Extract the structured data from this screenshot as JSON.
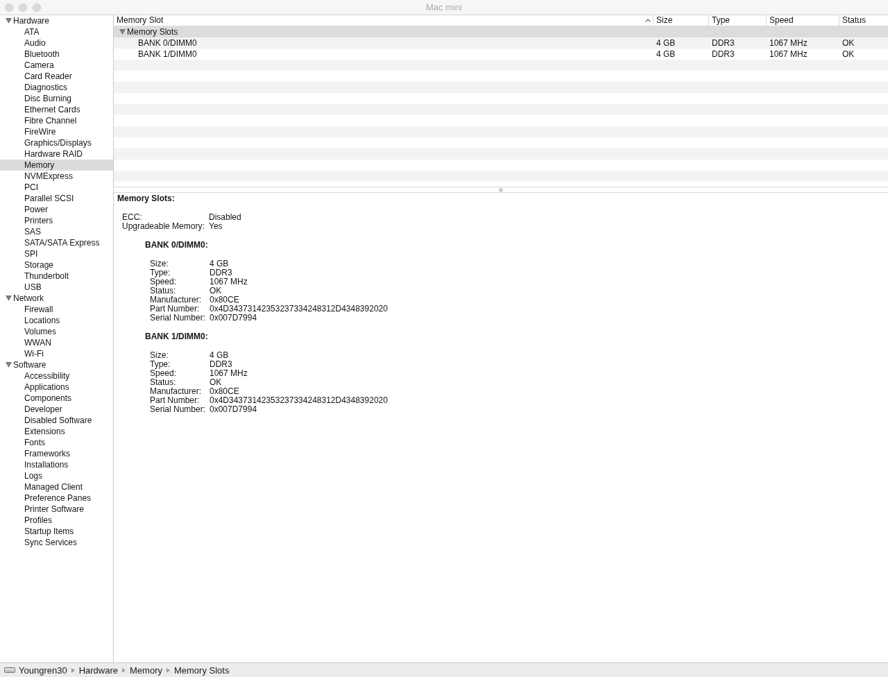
{
  "window": {
    "title": "Mac mini",
    "active": false
  },
  "sidebar": {
    "items": [
      {
        "label": "Hardware",
        "expanded": true,
        "selected": false,
        "children": [
          {
            "label": "ATA",
            "selected": false
          },
          {
            "label": "Audio",
            "selected": false
          },
          {
            "label": "Bluetooth",
            "selected": false
          },
          {
            "label": "Camera",
            "selected": false
          },
          {
            "label": "Card Reader",
            "selected": false
          },
          {
            "label": "Diagnostics",
            "selected": false
          },
          {
            "label": "Disc Burning",
            "selected": false
          },
          {
            "label": "Ethernet Cards",
            "selected": false
          },
          {
            "label": "Fibre Channel",
            "selected": false
          },
          {
            "label": "FireWire",
            "selected": false
          },
          {
            "label": "Graphics/Displays",
            "selected": false
          },
          {
            "label": "Hardware RAID",
            "selected": false
          },
          {
            "label": "Memory",
            "selected": true
          },
          {
            "label": "NVMExpress",
            "selected": false
          },
          {
            "label": "PCI",
            "selected": false
          },
          {
            "label": "Parallel SCSI",
            "selected": false
          },
          {
            "label": "Power",
            "selected": false
          },
          {
            "label": "Printers",
            "selected": false
          },
          {
            "label": "SAS",
            "selected": false
          },
          {
            "label": "SATA/SATA Express",
            "selected": false
          },
          {
            "label": "SPI",
            "selected": false
          },
          {
            "label": "Storage",
            "selected": false
          },
          {
            "label": "Thunderbolt",
            "selected": false
          },
          {
            "label": "USB",
            "selected": false
          }
        ]
      },
      {
        "label": "Network",
        "expanded": true,
        "selected": false,
        "children": [
          {
            "label": "Firewall",
            "selected": false
          },
          {
            "label": "Locations",
            "selected": false
          },
          {
            "label": "Volumes",
            "selected": false
          },
          {
            "label": "WWAN",
            "selected": false
          },
          {
            "label": "Wi-Fi",
            "selected": false
          }
        ]
      },
      {
        "label": "Software",
        "expanded": true,
        "selected": false,
        "children": [
          {
            "label": "Accessibility",
            "selected": false
          },
          {
            "label": "Applications",
            "selected": false
          },
          {
            "label": "Components",
            "selected": false
          },
          {
            "label": "Developer",
            "selected": false
          },
          {
            "label": "Disabled Software",
            "selected": false
          },
          {
            "label": "Extensions",
            "selected": false
          },
          {
            "label": "Fonts",
            "selected": false
          },
          {
            "label": "Frameworks",
            "selected": false
          },
          {
            "label": "Installations",
            "selected": false
          },
          {
            "label": "Logs",
            "selected": false
          },
          {
            "label": "Managed Client",
            "selected": false
          },
          {
            "label": "Preference Panes",
            "selected": false
          },
          {
            "label": "Printer Software",
            "selected": false
          },
          {
            "label": "Profiles",
            "selected": false
          },
          {
            "label": "Startup Items",
            "selected": false
          },
          {
            "label": "Sync Services",
            "selected": false
          }
        ]
      }
    ]
  },
  "table": {
    "columns": [
      {
        "label": "Memory Slot",
        "sorted": true
      },
      {
        "label": "Size",
        "sorted": false
      },
      {
        "label": "Type",
        "sorted": false
      },
      {
        "label": "Speed",
        "sorted": false
      },
      {
        "label": "Status",
        "sorted": false
      }
    ],
    "rows": [
      {
        "label": "Memory Slots",
        "expanded": true,
        "selected": true,
        "children": [
          {
            "cells": [
              "BANK 0/DIMM0",
              "4 GB",
              "DDR3",
              "1067 MHz",
              "OK"
            ],
            "selected": false
          },
          {
            "cells": [
              "BANK 1/DIMM0",
              "4 GB",
              "DDR3",
              "1067 MHz",
              "OK"
            ],
            "selected": false
          }
        ]
      }
    ]
  },
  "detail": {
    "title": "Memory Slots:",
    "fields": [
      {
        "label": "ECC:",
        "value": "Disabled"
      },
      {
        "label": "Upgradeable Memory:",
        "value": "Yes"
      }
    ],
    "sections": [
      {
        "title": "BANK 0/DIMM0:",
        "fields": [
          {
            "label": "Size:",
            "value": "4 GB"
          },
          {
            "label": "Type:",
            "value": "DDR3"
          },
          {
            "label": "Speed:",
            "value": "1067 MHz"
          },
          {
            "label": "Status:",
            "value": "OK"
          },
          {
            "label": "Manufacturer:",
            "value": "0x80CE"
          },
          {
            "label": "Part Number:",
            "value": "0x4D34373142353237334248312D4348392020"
          },
          {
            "label": "Serial Number:",
            "value": "0x007D7994"
          }
        ]
      },
      {
        "title": "BANK 1/DIMM0:",
        "fields": [
          {
            "label": "Size:",
            "value": "4 GB"
          },
          {
            "label": "Type:",
            "value": "DDR3"
          },
          {
            "label": "Speed:",
            "value": "1067 MHz"
          },
          {
            "label": "Status:",
            "value": "OK"
          },
          {
            "label": "Manufacturer:",
            "value": "0x80CE"
          },
          {
            "label": "Part Number:",
            "value": "0x4D34373142353237334248312D4348392020"
          },
          {
            "label": "Serial Number:",
            "value": "0x007D7994"
          }
        ]
      }
    ]
  },
  "status_bar": {
    "path": [
      "Youngren30",
      "Hardware",
      "Memory",
      "Memory Slots"
    ]
  }
}
